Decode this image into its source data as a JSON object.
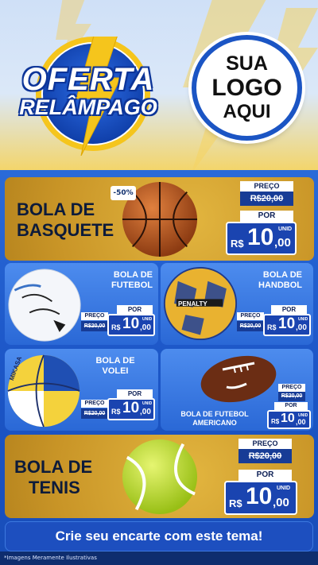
{
  "banner": {
    "line1": "OFERTA",
    "line2": "RELÂMPAGO"
  },
  "logo": {
    "line1": "SUA",
    "line2": "LOGO",
    "line3": "AQUI"
  },
  "basketball": {
    "title_l1": "BOLA DE",
    "title_l2": "BASQUETE",
    "badge": "-50%",
    "preco_label": "PREÇO",
    "old_price": "R$20,00",
    "por_label": "POR",
    "currency": "R$",
    "price_int": "10",
    "price_dec": ",00",
    "unid": "UNID"
  },
  "football": {
    "title_l1": "BOLA DE",
    "title_l2": "FUTEBOL",
    "preco_label": "PREÇO",
    "old_price": "R$20,00",
    "por_label": "POR",
    "currency": "R$",
    "price_int": "10",
    "price_dec": ",00",
    "unid": "UNID"
  },
  "handball": {
    "title_l1": "BOLA DE",
    "title_l2": "HANDBOL",
    "brand": "PENALTY",
    "preco_label": "PREÇO",
    "old_price": "R$20,00",
    "por_label": "POR",
    "currency": "R$",
    "price_int": "10",
    "price_dec": ",00",
    "unid": "UNID"
  },
  "volley": {
    "title_l1": "BOLA DE",
    "title_l2": "VOLEI",
    "brand": "MIKASA",
    "preco_label": "PREÇO",
    "old_price": "R$20,00",
    "por_label": "POR",
    "currency": "R$",
    "price_int": "10",
    "price_dec": ",00",
    "unid": "UNID"
  },
  "american": {
    "title_l1": "BOLA DE FUTEBOL",
    "title_l2": "AMERICANO",
    "preco_label": "PREÇO",
    "old_price": "R$20,00",
    "por_label": "POR",
    "currency": "R$",
    "price_int": "10",
    "price_dec": ",00",
    "unid": "UNID"
  },
  "tennis": {
    "title_l1": "BOLA DE",
    "title_l2": "TENIS",
    "preco_label": "PREÇO",
    "old_price": "R$20,00",
    "por_label": "POR",
    "currency": "R$",
    "price_int": "10",
    "price_dec": ",00",
    "unid": "UNID"
  },
  "cta": "Crie seu encarte com este tema!",
  "footer": "*Imagens Meramente Ilustrativas",
  "colors": {
    "gold": "#c99527",
    "blue": "#2a68d6",
    "dark_blue": "#1a44b0",
    "yellow_bolt": "#f5c51c"
  }
}
